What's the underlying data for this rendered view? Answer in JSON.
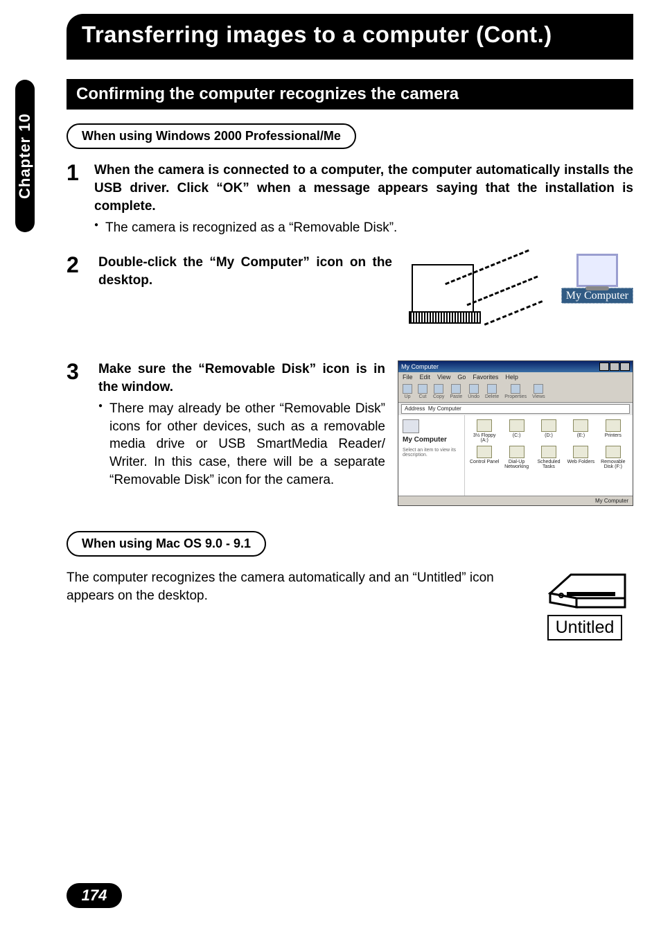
{
  "chapter_tab": "Chapter 10",
  "page_title": "Transferring images to a computer (Cont.)",
  "subsection": "Confirming the computer recognizes the camera",
  "pill_windows": "When using Windows 2000 Professional/Me",
  "steps": {
    "s1": {
      "num": "1",
      "bold": "When the camera is connected to a computer, the computer automatically installs the USB driver. Click “OK” when a message appears saying that the installation is complete.",
      "bullet": "The camera is recognized as a “Removable Disk”."
    },
    "s2": {
      "num": "2",
      "bold": "Double-click the “My Computer” icon on the desktop."
    },
    "s3": {
      "num": "3",
      "bold": "Make sure the “Removable Disk” icon is in the window.",
      "bullet": "There may already be other “Removable Disk” icons for other devices, such as a removable media drive or USB SmartMedia Reader/ Writer. In this case, there will be a separate “Removable Disk” icon for the camera."
    }
  },
  "mycomputer_label": "My Computer",
  "explorer": {
    "title": "My Computer",
    "menus": [
      "File",
      "Edit",
      "View",
      "Go",
      "Favorites",
      "Help"
    ],
    "toolbar": [
      "Up",
      "Cut",
      "Copy",
      "Paste",
      "Undo",
      "Delete",
      "Properties",
      "Views"
    ],
    "address_label": "Address",
    "address_value": "My Computer",
    "side_title": "My Computer",
    "side_hint": "Select an item to view its description.",
    "items": [
      "3½ Floppy (A:)",
      "(C:)",
      "(D:)",
      "(E:)",
      "Printers",
      "Control Panel",
      "Dial-Up Networking",
      "Scheduled Tasks",
      "Web Folders",
      "Removable Disk (F:)"
    ],
    "status": "My Computer"
  },
  "pill_mac": "When using Mac OS 9.0 - 9.1",
  "mac_text": "The computer recognizes the camera automatically and an “Untitled” icon appears on the desktop.",
  "mac_label": "Untitled",
  "page_number": "174"
}
